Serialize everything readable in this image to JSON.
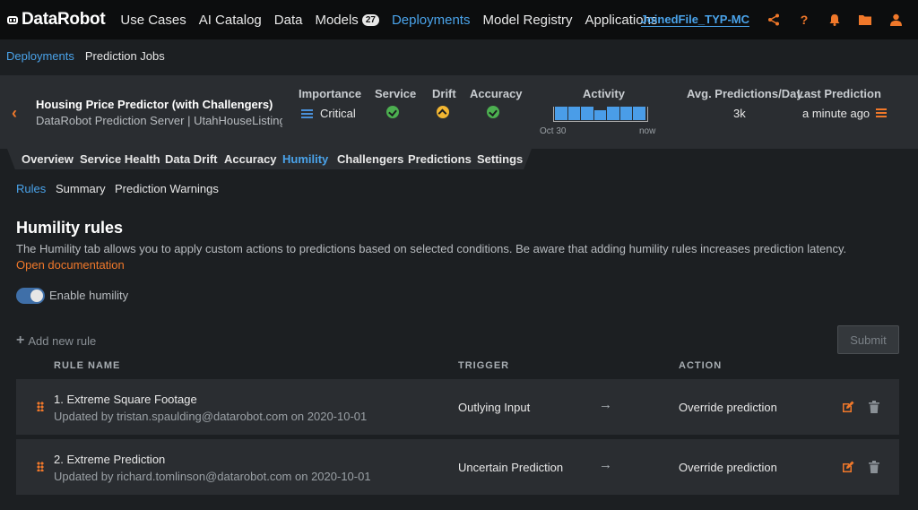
{
  "topnav": {
    "logo": "DataRobot",
    "items": [
      {
        "label": "Use Cases"
      },
      {
        "label": "AI Catalog"
      },
      {
        "label": "Data"
      },
      {
        "label": "Models",
        "badge": "27"
      },
      {
        "label": "Deployments",
        "active": true
      },
      {
        "label": "Model Registry"
      },
      {
        "label": "Applications"
      }
    ],
    "project": "JoinedFile_TYP-MC",
    "icons": [
      "share-icon",
      "help-icon",
      "bell-icon",
      "folder-icon",
      "user-icon"
    ]
  },
  "breadcrumb": {
    "link": "Deployments",
    "current": "Prediction Jobs"
  },
  "deployment": {
    "title": "Housing Price Predictor (with Challengers)",
    "subtitle": "DataRobot Prediction Server | UtahHouseListings...",
    "columns": {
      "importance": {
        "label": "Importance",
        "value": "Critical"
      },
      "service": {
        "label": "Service",
        "status": "green"
      },
      "drift": {
        "label": "Drift",
        "status": "yellow"
      },
      "accuracy": {
        "label": "Accuracy",
        "status": "green"
      },
      "activity": {
        "label": "Activity",
        "start": "Oct 30",
        "end": "now",
        "bar_levels": [
          1.0,
          1.0,
          1.0,
          0.75,
          1.0,
          1.0,
          1.0
        ]
      },
      "avg_predictions": {
        "label": "Avg. Predictions/Day",
        "value": "3k"
      },
      "last_prediction": {
        "label": "Last Prediction",
        "value": "a minute ago"
      }
    }
  },
  "tabs": [
    {
      "label": "Overview"
    },
    {
      "label": "Service Health"
    },
    {
      "label": "Data Drift"
    },
    {
      "label": "Accuracy"
    },
    {
      "label": "Humility",
      "active": true
    },
    {
      "label": "Challengers"
    },
    {
      "label": "Predictions"
    },
    {
      "label": "Settings"
    }
  ],
  "subtabs": [
    {
      "label": "Rules",
      "active": true
    },
    {
      "label": "Summary"
    },
    {
      "label": "Prediction Warnings"
    }
  ],
  "content": {
    "title": "Humility rules",
    "description": "The Humility tab allows you to apply custom actions to predictions based on selected conditions. Be aware that adding humility rules increases prediction latency.",
    "doc_link": "Open documentation",
    "toggle_label": "Enable humility",
    "toggle_on": true,
    "add_rule": "Add new rule",
    "submit": "Submit"
  },
  "table": {
    "headers": {
      "name": "RULE NAME",
      "trigger": "TRIGGER",
      "action": "ACTION"
    },
    "rows": [
      {
        "name": "1. Extreme Square Footage",
        "updated": "Updated by tristan.spaulding@datarobot.com on 2020-10-01",
        "trigger": "Outlying Input",
        "action": "Override prediction"
      },
      {
        "name": "2. Extreme Prediction",
        "updated": "Updated by richard.tomlinson@datarobot.com on 2020-10-01",
        "trigger": "Uncertain Prediction",
        "action": "Override prediction"
      }
    ]
  },
  "colors": {
    "accent_blue": "#4aa3ea",
    "accent_orange": "#f0782a",
    "status_green": "#4caf50",
    "status_yellow": "#f2b632"
  }
}
